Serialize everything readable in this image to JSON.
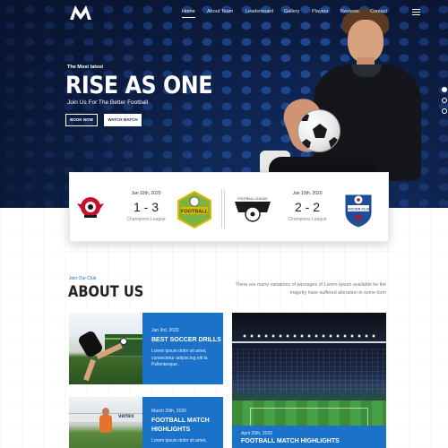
{
  "nav": {
    "items": [
      {
        "label": "Home"
      },
      {
        "label": "About Team"
      },
      {
        "label": "Leaderboard"
      },
      {
        "label": "Gallery"
      },
      {
        "label": "Players"
      },
      {
        "label": "Reviews"
      },
      {
        "label": "Contact"
      }
    ],
    "active": "Home"
  },
  "hero": {
    "eyebrow": "The Most latest",
    "title": "RISE AS ONE",
    "subtitle": "Join Us For The Better Football",
    "btn_book": "BOOK NOW",
    "btn_watch": "WATCH MATCH"
  },
  "matches": [
    {
      "date": "Jan 10th, 2020",
      "score": "1 - 3",
      "league": "Champions League",
      "home_badge_text": "",
      "away_badge_text": "FOOTBALL"
    },
    {
      "date": "Jan 10th, 2020",
      "score": "2 - 2",
      "league": "Champions League",
      "home_badge_text": "FOOTBALL LEAGUE",
      "away_badge_text": "SOCCER CLUB"
    }
  ],
  "about": {
    "eyebrow": "Join Our Club",
    "title": "ABOUT US",
    "text": "There are many variations of passages of Lorem Ipsum available be the majority have suffered alteration in some form"
  },
  "cards": [
    {
      "date": "Jan 3rd, 2020",
      "title": "BEST SOCCER DRILLS",
      "desc": "Lorem ipsum dolor sit amet, consectetur adipiscing elit la Pellentesque ."
    },
    {
      "date": "March 20th, 2020",
      "title": "FOOTBALL MATCH HIGHLIGHTS",
      "desc": "Lorem ipsum dolor sit amet,"
    },
    {
      "date": "April 20th, 2020",
      "title": "FOOTBALL MATCH HIGHLIGHTS"
    }
  ],
  "photo_board_text": "vertex",
  "colors": {
    "accent": "#1a72c9",
    "hero_dark": "#0c1a3a"
  }
}
